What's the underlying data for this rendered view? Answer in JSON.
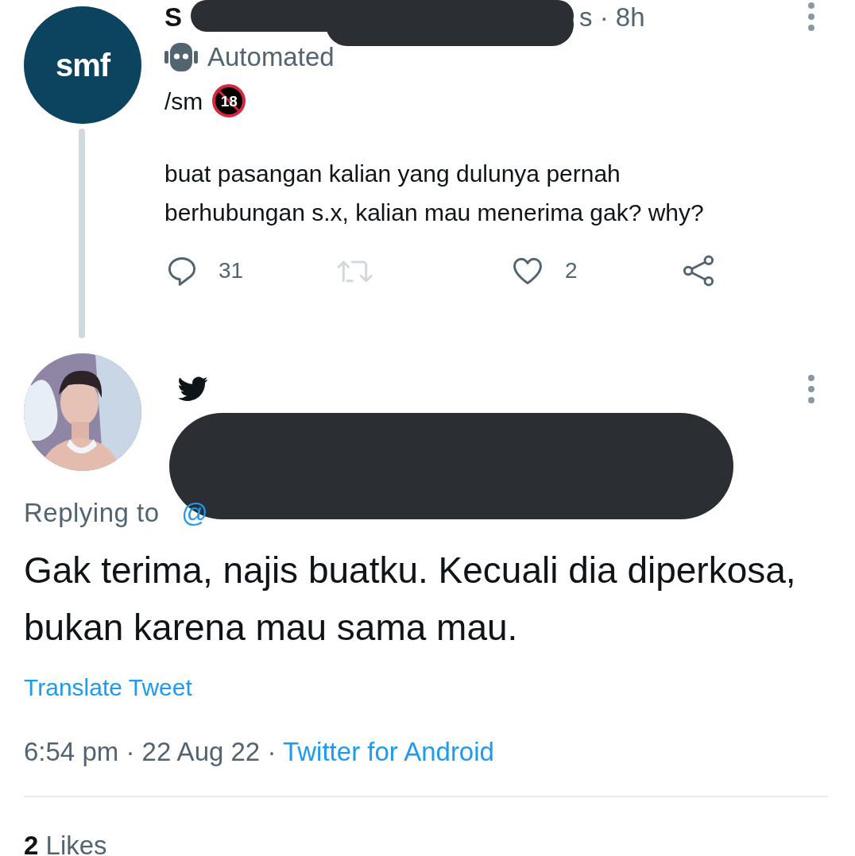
{
  "parent_tweet": {
    "avatar_text": "smf",
    "name_visible": "S",
    "handle_time": "s · 8h",
    "label": "Automated",
    "prefix": "/sm",
    "rating": "18",
    "body": [
      "buat pasangan kalian yang dulunya pernah",
      "berhubungan s.x, kalian mau menerima gak? why?"
    ],
    "actions": [
      {
        "kind": "reply",
        "count": "31",
        "disabled": false
      },
      {
        "kind": "retweet",
        "disabled": true
      },
      {
        "kind": "like",
        "count": "2",
        "disabled": false
      },
      {
        "kind": "share",
        "disabled": false
      }
    ]
  },
  "reply_tweet": {
    "replying_prefix": "Replying to",
    "replying_handle_visible": "@",
    "body": "Gak terima, najis buatku. Kecuali dia diperkosa, bukan karena mau sama mau.",
    "translate": "Translate Tweet",
    "timestamp": "6:54 pm · 22 Aug 22 · ",
    "source": "Twitter for Android",
    "likes_count": "2",
    "likes_label": "Likes"
  }
}
